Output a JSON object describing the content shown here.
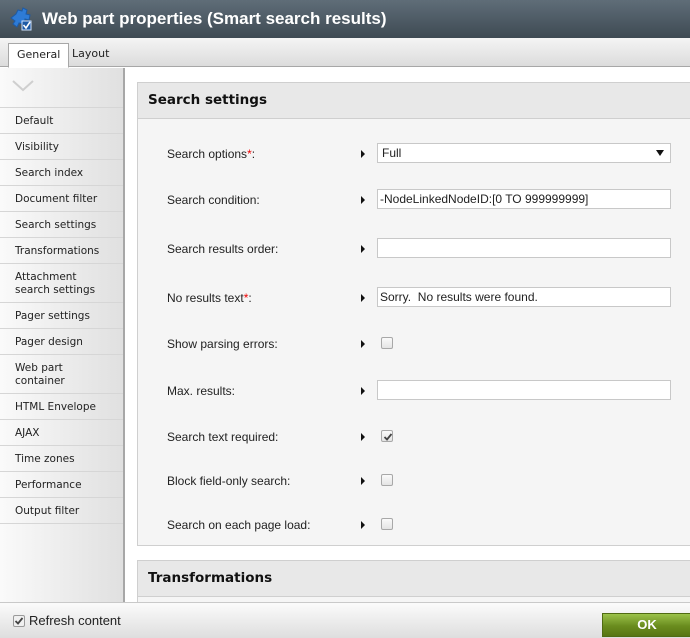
{
  "window": {
    "title": "Web part properties (Smart search results)",
    "icon": "puzzle-piece-icon"
  },
  "tabs": [
    {
      "label": "General",
      "active": true
    },
    {
      "label": "Layout",
      "active": false
    }
  ],
  "sidebar": {
    "collapse_icon": "chevron-down-icon",
    "items": [
      {
        "label": "Default"
      },
      {
        "label": "Visibility"
      },
      {
        "label": "Search index"
      },
      {
        "label": "Document filter"
      },
      {
        "label": "Search settings"
      },
      {
        "label": "Transformations"
      },
      {
        "label": "Attachment search settings"
      },
      {
        "label": "Pager settings"
      },
      {
        "label": "Pager design"
      },
      {
        "label": "Web part container"
      },
      {
        "label": "HTML Envelope"
      },
      {
        "label": "AJAX"
      },
      {
        "label": "Time zones"
      },
      {
        "label": "Performance"
      },
      {
        "label": "Output filter"
      }
    ]
  },
  "search_settings": {
    "heading": "Search settings",
    "required_mark": "*",
    "fields": {
      "search_options": {
        "label": "Search options",
        "suffix": ":",
        "value": "Full"
      },
      "search_condition": {
        "label": "Search condition:",
        "value": "-NodeLinkedNodeID:[0 TO 999999999]"
      },
      "search_results_order": {
        "label": "Search results order:",
        "value": ""
      },
      "no_results_text": {
        "label": "No results text",
        "suffix": ":",
        "value": "Sorry.  No results were found."
      },
      "show_parsing_errors": {
        "label": "Show parsing errors:",
        "checked": false
      },
      "max_results": {
        "label": "Max. results:",
        "value": ""
      },
      "search_text_required": {
        "label": "Search text required:",
        "checked": true
      },
      "block_field_only_search": {
        "label": "Block field-only search:",
        "checked": false
      },
      "search_on_each_page_load": {
        "label": "Search on each page load:",
        "checked": false
      }
    }
  },
  "transformations": {
    "heading": "Transformations"
  },
  "footer": {
    "refresh_label": "Refresh content",
    "refresh_checked": true,
    "ok_label": "OK"
  },
  "colors": {
    "title_bar": "#4d5962",
    "ok_button": "#6a8c1e",
    "required": "#e00000"
  }
}
